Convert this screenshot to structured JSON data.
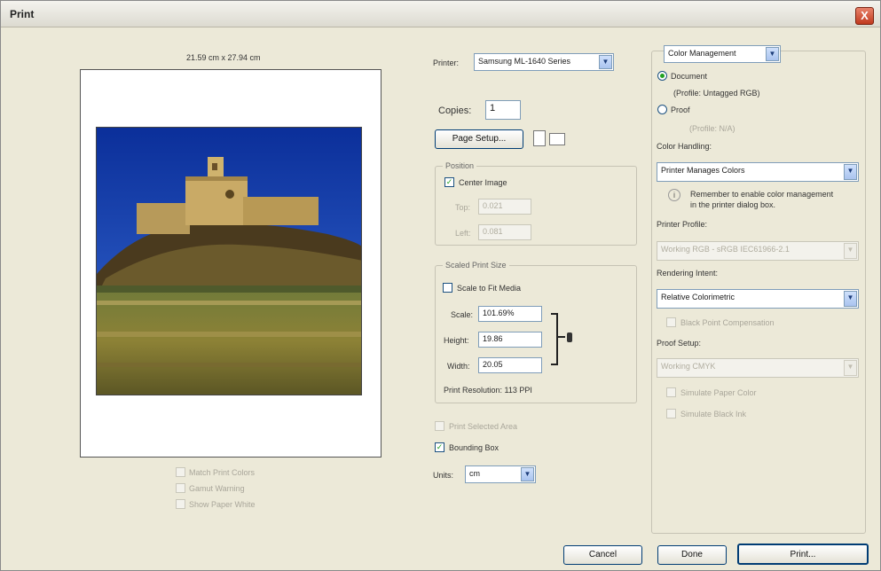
{
  "window": {
    "title": "Print",
    "close_glyph": "X"
  },
  "preview": {
    "size_label": "21.59 cm x 27.94 cm",
    "image_alt": "castle on hilltop photo",
    "options": [
      {
        "label": "Match Print Colors",
        "checked": false,
        "enabled": false
      },
      {
        "label": "Gamut Warning",
        "checked": false,
        "enabled": false
      },
      {
        "label": "Show Paper White",
        "checked": false,
        "enabled": false
      }
    ]
  },
  "printer": {
    "label": "Printer:",
    "value": "Samsung ML-1640 Series",
    "copies_label": "Copies:",
    "copies_value": "1",
    "page_setup_label": "Page Setup..."
  },
  "position": {
    "title": "Position",
    "center_image_label": "Center Image",
    "center_image_checked": true,
    "top_label": "Top:",
    "top_value": "0.021",
    "left_label": "Left:",
    "left_value": "0.081"
  },
  "scaled": {
    "title": "Scaled Print Size",
    "scale_to_fit_label": "Scale to Fit Media",
    "scale_to_fit_checked": false,
    "scale_label": "Scale:",
    "scale_value": "101.69%",
    "height_label": "Height:",
    "height_value": "19.86",
    "width_label": "Width:",
    "width_value": "20.05",
    "resolution": "Print Resolution: 113 PPI"
  },
  "lower": {
    "print_selected_label": "Print Selected Area",
    "print_selected_checked": false,
    "bounding_box_label": "Bounding Box",
    "bounding_box_checked": true,
    "units_label": "Units:",
    "units_value": "cm"
  },
  "color": {
    "section_value": "Color Management",
    "document_label": "Document",
    "document_selected": true,
    "document_profile": "(Profile: Untagged RGB)",
    "proof_label": "Proof",
    "proof_profile": "(Profile: N/A)",
    "handling_label": "Color Handling:",
    "handling_value": "Printer Manages Colors",
    "info_icon": "i",
    "info_text_1": "Remember to enable color management",
    "info_text_2": "in the printer dialog box.",
    "printer_profile_label": "Printer Profile:",
    "printer_profile_value": "Working RGB - sRGB IEC61966-2.1",
    "intent_label": "Rendering Intent:",
    "intent_value": "Relative Colorimetric",
    "bpc_label": "Black Point Compensation",
    "proof_setup_label": "Proof Setup:",
    "proof_setup_value": "Working CMYK",
    "simulate_paper_label": "Simulate Paper Color",
    "simulate_black_label": "Simulate Black Ink"
  },
  "buttons": {
    "cancel": "Cancel",
    "done": "Done",
    "print": "Print..."
  }
}
